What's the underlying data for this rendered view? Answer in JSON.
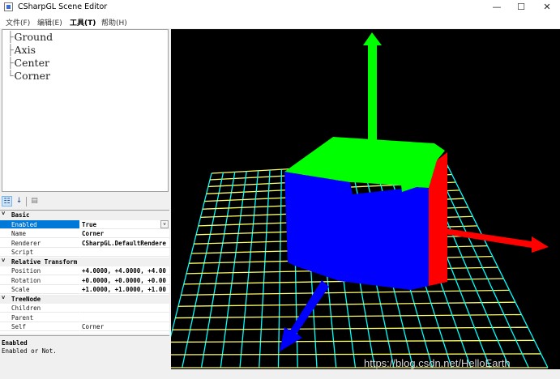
{
  "window": {
    "title": "CSharpGL Scene Editor",
    "controls": {
      "minimize": "—",
      "maximize": "☐",
      "close": "✕"
    }
  },
  "menu": [
    {
      "label": "文件(F)"
    },
    {
      "label": "编辑(E)"
    },
    {
      "label": "工具(T)"
    },
    {
      "label": "帮助(H)"
    }
  ],
  "tree": {
    "items": [
      {
        "label": "Ground"
      },
      {
        "label": "Axis"
      },
      {
        "label": "Center"
      },
      {
        "label": "Corner"
      }
    ]
  },
  "toolbar": {
    "categorized_icon": "categorized-icon",
    "alphabetical_icon": "alphabetical-icon",
    "property_pages_icon": "property-pages-icon"
  },
  "properties": {
    "categories": [
      {
        "name": "Basic",
        "rows": [
          {
            "name": "Enabled",
            "value": "True"
          },
          {
            "name": "Name",
            "value": "Corner"
          },
          {
            "name": "Renderer",
            "value": "CSharpGL.DefaultRendere"
          },
          {
            "name": "Script",
            "value": ""
          }
        ]
      },
      {
        "name": "Relative Transform",
        "rows": [
          {
            "name": "Position",
            "value": "+4.0000, +4.0000, +4.00"
          },
          {
            "name": "Rotation",
            "value": "+0.0000, +0.0000, +0.00"
          },
          {
            "name": "Scale",
            "value": "+1.0000, +1.0000, +1.00"
          }
        ]
      },
      {
        "name": "TreeNode",
        "rows": [
          {
            "name": "Children",
            "value": ""
          },
          {
            "name": "Parent",
            "value": ""
          },
          {
            "name": "Self",
            "value": "Corner"
          }
        ]
      }
    ]
  },
  "help": {
    "title": "Enabled",
    "description": "Enabled or Not."
  },
  "viewport": {
    "colors": {
      "background": "#000000",
      "green": "#00ff00",
      "blue": "#0000ff",
      "red": "#ff0000",
      "grid_yellow": "#ffff66",
      "grid_cyan": "#00ffff"
    }
  },
  "watermark": "https://blog.csdn.net/HelloEarth"
}
